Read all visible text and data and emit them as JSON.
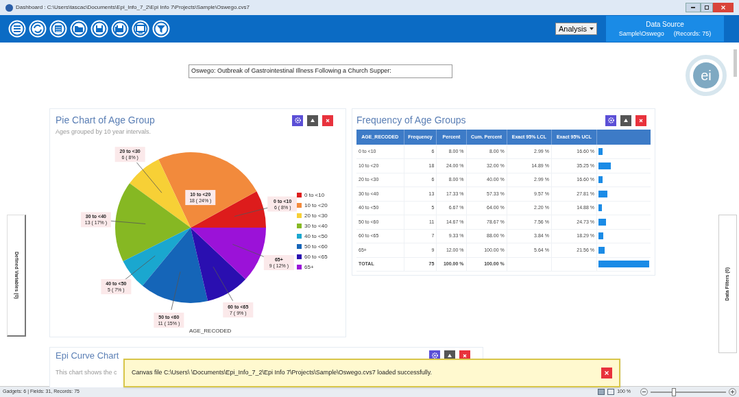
{
  "window": {
    "title": "Dashboard : C:\\Users\\tascac\\Documents\\Epi_Info_7_2\\Epi Info 7\\Projects\\Sample\\Oswego.cvs7"
  },
  "toolbar": {
    "analysis_button": "Analysis",
    "data_source": {
      "heading": "Data Source",
      "name": "Sample\\Oswego",
      "records": "(Records: 75)"
    }
  },
  "logo_text": "ei",
  "canvas_title": "Oswego: Outbreak of Gastrointestinal Illness Following a Church Supper:",
  "side_tabs": {
    "left": "Defined Variables (0)",
    "right": "Data Filters (0)"
  },
  "pie_gadget": {
    "title": "Pie Chart of Age Group",
    "subtitle": "Ages grouped by 10 year intervals.",
    "chart_data": {
      "type": "pie",
      "xlabel": "AGE_RECODED",
      "categories": [
        "0 to <10",
        "10 to <20",
        "20 to <30",
        "30 to <40",
        "40 to <50",
        "50 to <60",
        "60 to <65",
        "65+"
      ],
      "values": [
        6,
        18,
        6,
        13,
        5,
        11,
        7,
        9
      ],
      "value_labels": [
        "6 ( 8% )",
        "18 ( 24% )",
        "6 ( 8% )",
        "13 ( 17% )",
        "5 ( 7% )",
        "11 ( 15% )",
        "7 ( 9% )",
        "9 ( 12% )"
      ]
    },
    "legend": [
      {
        "label": "0 to <10",
        "color": "#dd1c1c"
      },
      {
        "label": "10 to <20",
        "color": "#f28a3c"
      },
      {
        "label": "20 to <30",
        "color": "#f7d036"
      },
      {
        "label": "30 to <40",
        "color": "#86b823"
      },
      {
        "label": "40 to <50",
        "color": "#1aa7cf"
      },
      {
        "label": "50 to <60",
        "color": "#1565b8"
      },
      {
        "label": "60 to <65",
        "color": "#2a0fb0"
      },
      {
        "label": "65+",
        "color": "#9b12d8"
      }
    ]
  },
  "frequency_gadget": {
    "title": "Frequency of Age Groups",
    "columns": [
      "AGE_RECODED",
      "Frequency",
      "Percent",
      "Cum. Percent",
      "Exact 95% LCL",
      "Exact 95% UCL"
    ],
    "rows": [
      {
        "cells": [
          "0 to <10",
          "6",
          "8.00 %",
          "8.00 %",
          "2.99 %",
          "16.60 %"
        ],
        "level": 0.08
      },
      {
        "cells": [
          "10 to <20",
          "18",
          "24.00 %",
          "32.00 %",
          "14.89 %",
          "35.25 %"
        ],
        "level": 0.24
      },
      {
        "cells": [
          "20 to <30",
          "6",
          "8.00 %",
          "40.00 %",
          "2.99 %",
          "16.60 %"
        ],
        "level": 0.08
      },
      {
        "cells": [
          "30 to <40",
          "13",
          "17.33 %",
          "57.33 %",
          "9.57 %",
          "27.81 %"
        ],
        "level": 0.1733
      },
      {
        "cells": [
          "40 to <50",
          "5",
          "6.67 %",
          "64.00 %",
          "2.20 %",
          "14.88 %"
        ],
        "level": 0.0667
      },
      {
        "cells": [
          "50 to <60",
          "11",
          "14.67 %",
          "78.67 %",
          "7.56 %",
          "24.73 %"
        ],
        "level": 0.1467
      },
      {
        "cells": [
          "60 to <65",
          "7",
          "9.33 %",
          "88.00 %",
          "3.84 %",
          "18.29 %"
        ],
        "level": 0.0933
      },
      {
        "cells": [
          "65+",
          "9",
          "12.00 %",
          "100.00 %",
          "5.64 %",
          "21.56 %"
        ],
        "level": 0.12
      }
    ],
    "total": {
      "cells": [
        "TOTAL",
        "75",
        "100.00 %",
        "100.00 %",
        "",
        ""
      ],
      "level": 1
    }
  },
  "epi_gadget": {
    "title": "Epi Curve Chart",
    "subtitle": "This chart shows the c"
  },
  "toast": {
    "message": "Canvas file C:\\Users\\ \\Documents\\Epi_Info_7_2\\Epi Info 7\\Projects\\Sample\\Oswego.cvs7 loaded successfully."
  },
  "status_bar": {
    "left": "Gadgets: 6 | Fields: 31, Records: 75",
    "zoom": "100 %",
    "zoom_slider": {
      "level": 0.3
    }
  }
}
